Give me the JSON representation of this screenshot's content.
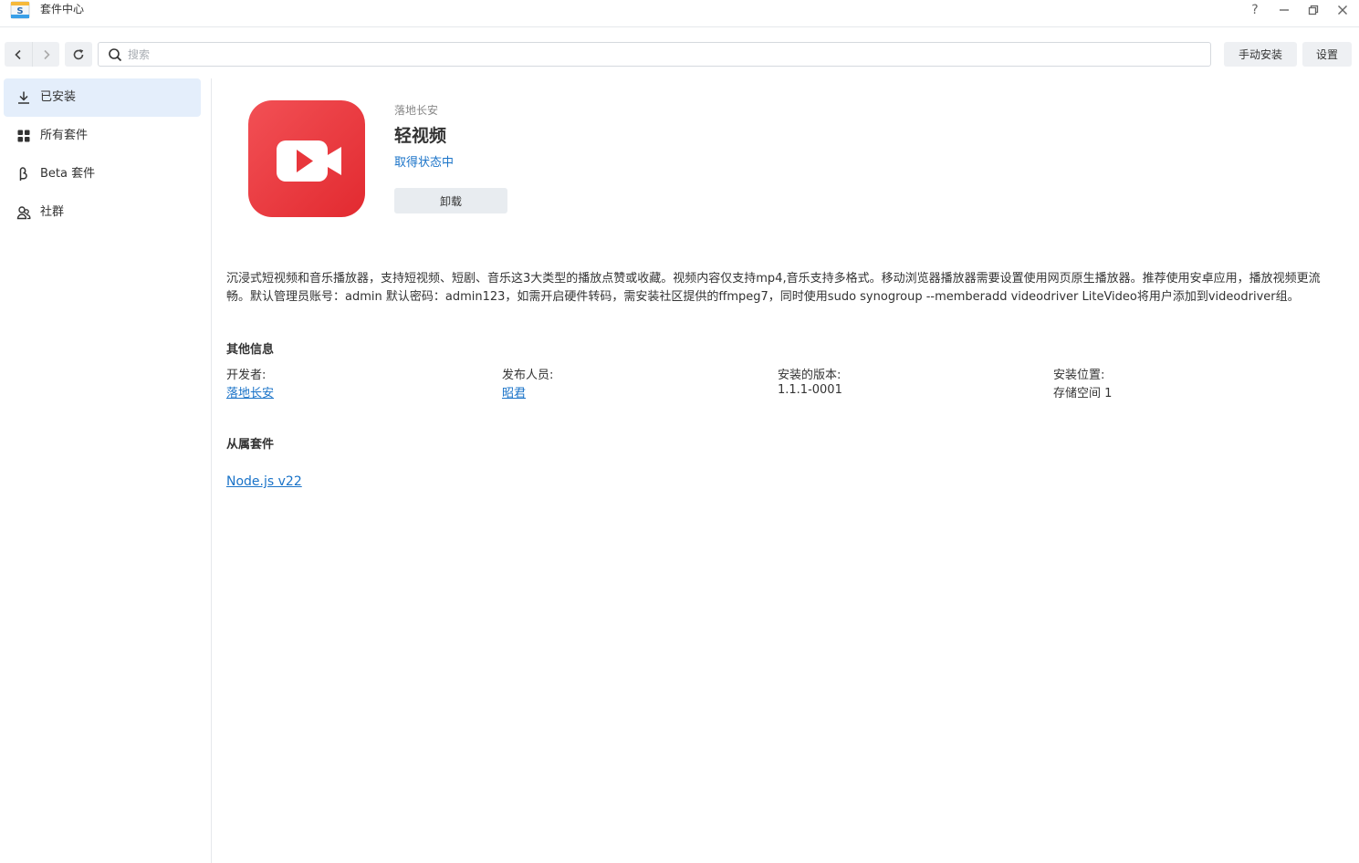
{
  "window": {
    "title": "套件中心",
    "help_glyph": "?"
  },
  "toolbar": {
    "search_placeholder": "搜索",
    "manual_install_label": "手动安装",
    "settings_label": "设置"
  },
  "sidebar": {
    "items": [
      {
        "label": "已安装",
        "icon": "download-icon",
        "active": true
      },
      {
        "label": "所有套件",
        "icon": "grid-icon",
        "active": false
      },
      {
        "label": "Beta 套件",
        "icon": "beta-icon",
        "active": false
      },
      {
        "label": "社群",
        "icon": "community-icon",
        "active": false
      }
    ]
  },
  "package": {
    "developer": "落地长安",
    "name": "轻视频",
    "status": "取得状态中",
    "uninstall_label": "卸载",
    "icon_color": "#e8363b",
    "description": "沉浸式短视频和音乐播放器，支持短视频、短剧、音乐这3大类型的播放点赞或收藏。视频内容仅支持mp4,音乐支持多格式。移动浏览器播放器需要设置使用网页原生播放器。推荐使用安卓应用，播放视频更流畅。默认管理员账号：admin 默认密码：admin123，如需开启硬件转码，需安装社区提供的ffmpeg7，同时使用sudo synogroup --memberadd videodriver LiteVideo将用户添加到videodriver组。"
  },
  "other_info": {
    "title": "其他信息",
    "developer_label": "开发者:",
    "developer_value": "落地长安",
    "publisher_label": "发布人员:",
    "publisher_value": "昭君",
    "version_label": "安装的版本:",
    "version_value": "1.1.1-0001",
    "location_label": "安装位置:",
    "location_value": "存储空间 1"
  },
  "dependencies": {
    "title": "从属套件",
    "items": [
      "Node.js v22"
    ]
  },
  "colors": {
    "accent": "#1a73c8",
    "active_bg": "#e4eefb"
  }
}
